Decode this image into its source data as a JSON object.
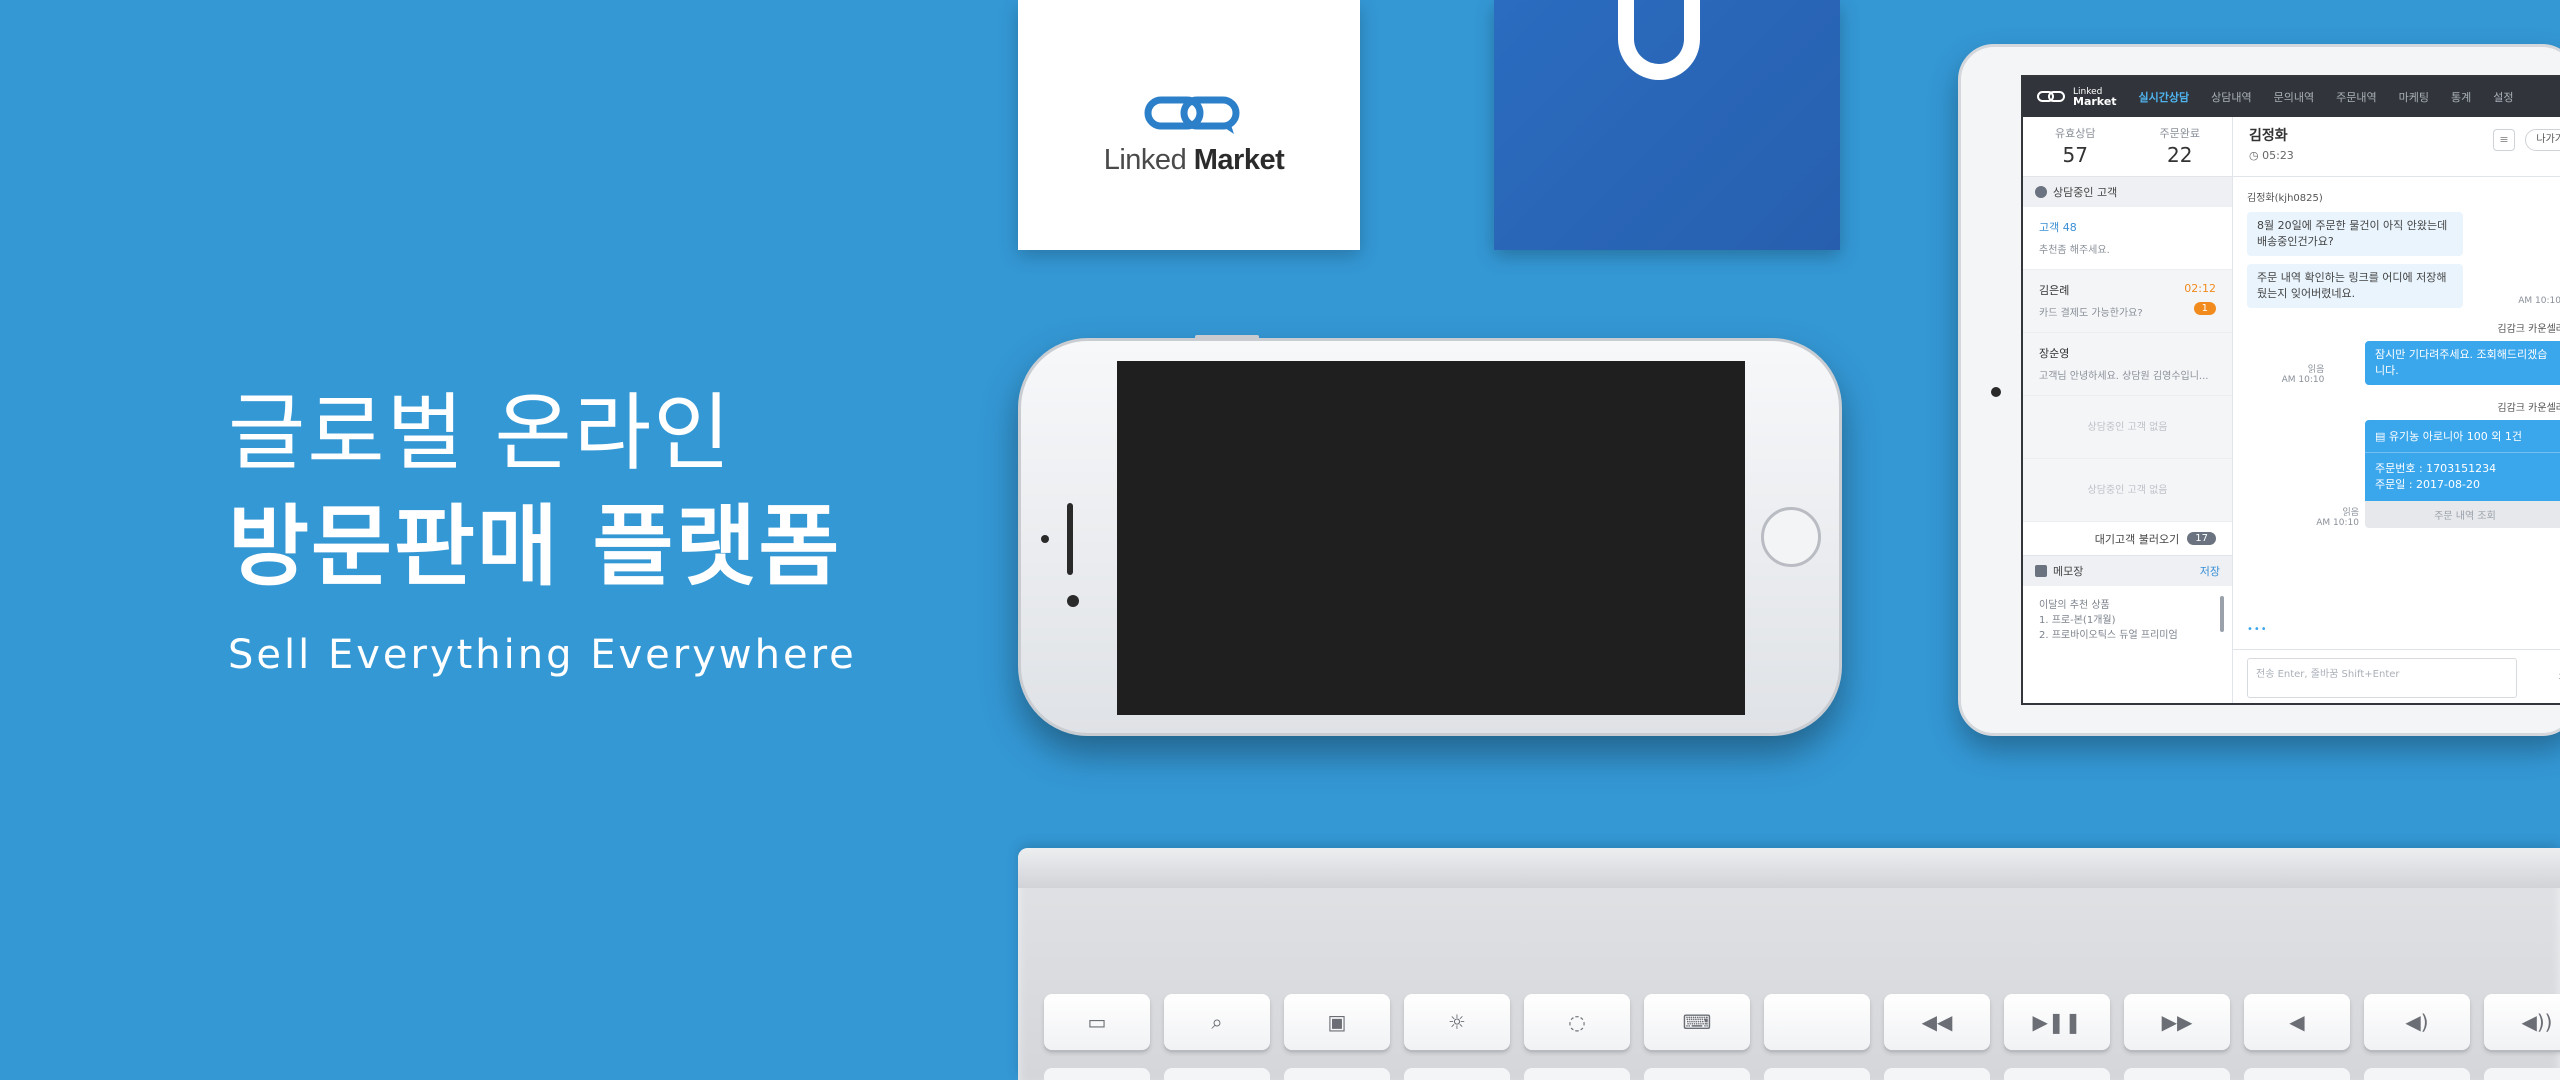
{
  "hero": {
    "line1": "글로벌 온라인",
    "line2": "방문판매 플랫폼",
    "tagline": "Sell Everything Everywhere"
  },
  "brand": {
    "name_light": "Linked",
    "name_bold": "Market",
    "accent": "#3498d5",
    "logo_color": "#2c7fc9"
  },
  "app": {
    "logo_top": "Linked",
    "logo_bottom": "Market",
    "nav": [
      "실시간상담",
      "상담내역",
      "문의내역",
      "주문내역",
      "마케팅",
      "통계",
      "설정"
    ],
    "stats": [
      {
        "label": "유효상담",
        "value": "57"
      },
      {
        "label": "주문완료",
        "value": "22"
      }
    ],
    "consulting_title": "상담중인 고객",
    "sessions": [
      {
        "name": "고객 48",
        "msg": "추천좀 해주세요.",
        "time": "",
        "badge": ""
      },
      {
        "name": "김은례",
        "msg": "카드 결제도 가능한가요?",
        "time": "02:12",
        "badge": "1"
      },
      {
        "name": "장순영",
        "msg": "고객님 안녕하세요. 상담원 김영수입니...",
        "time": "",
        "badge": ""
      }
    ],
    "empty_slots": [
      "상담중인 고객 없음",
      "상담중인 고객 없음"
    ],
    "waiting_label": "대기고객 불러오기",
    "waiting_count": "17",
    "memo_title": "메모장",
    "memo_save": "저장",
    "memo_lines": [
      "이달의 추천 상품",
      "1. 프로-본(1개월)",
      "2. 프로바이오틱스 듀얼 프리미엄"
    ],
    "chat": {
      "name": "김정화",
      "timer": "05:23",
      "doc_icon": "≡",
      "exit_label": "나가기",
      "customer_id": "김정화(kjh0825)",
      "customer_msgs": [
        "8월 20일에 주문한 물건이 아직 안왔는데 배송중인건가요?",
        "주문 내역 확인하는 링크를 어디에 저장해 뒀는지 잊어버렸네요."
      ],
      "customer_time": "AM 10:10",
      "agent_name": "김감크 카운셀러",
      "agent_msg": "잠시만 기다려주세요. 조회해드리겠습니다.",
      "read_label": "읽음",
      "agent_time": "AM 10:10",
      "agent_name2": "김감크 카운셀러",
      "order_title": "유기농 아로니아 100 외 1건",
      "order_no": "주문번호 : 1703151234",
      "order_date": "주문일 : 2017-08-20",
      "order_button": "주문 내역 조회",
      "read_label2": "읽음",
      "agent_time2": "AM 10:10",
      "typing": "•••",
      "compose_placeholder": "전송 Enter, 줄바꿈 Shift+Enter",
      "send_label": "전송"
    }
  },
  "keyboard_keys": [
    "▭",
    "⌕",
    "▣",
    "☼",
    "◌",
    "⌨",
    "",
    "◀◀",
    "▶❚❚",
    "▶▶",
    "◀",
    "◀)",
    "◀))"
  ]
}
